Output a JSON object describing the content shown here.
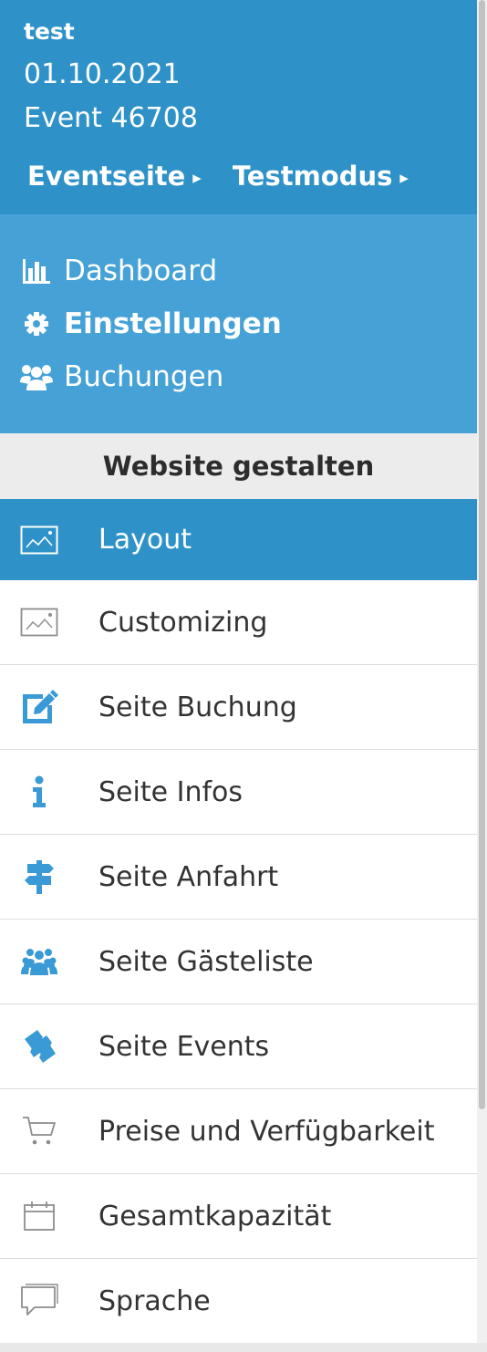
{
  "event": {
    "name": "test",
    "date": "01.10.2021",
    "id": "Event 46708",
    "links": [
      {
        "label": "Eventseite",
        "arrow": "▸"
      },
      {
        "label": "Testmodus",
        "arrow": "▸"
      }
    ]
  },
  "nav": {
    "items": [
      {
        "label": "Dashboard",
        "icon": "bar-chart-icon"
      },
      {
        "label": "Einstellungen",
        "icon": "gear-icon",
        "active": true
      },
      {
        "label": "Buchungen",
        "icon": "users-icon"
      }
    ]
  },
  "section": {
    "title": "Website gestalten"
  },
  "menu": {
    "items": [
      {
        "label": "Layout",
        "icon": "picture-icon",
        "active": true
      },
      {
        "label": "Customizing",
        "icon": "picture-icon"
      },
      {
        "label": "Seite Buchung",
        "icon": "edit-icon"
      },
      {
        "label": "Seite Infos",
        "icon": "info-icon"
      },
      {
        "label": "Seite Anfahrt",
        "icon": "signpost-icon"
      },
      {
        "label": "Seite Gästeliste",
        "icon": "users-icon"
      },
      {
        "label": "Seite Events",
        "icon": "tickets-icon"
      },
      {
        "label": "Preise und Verfügbarkeit",
        "icon": "cart-icon"
      },
      {
        "label": "Gesamtkapazität",
        "icon": "calendar-icon"
      },
      {
        "label": "Sprache",
        "icon": "speech-bubble-icon"
      }
    ]
  },
  "colors": {
    "primary": "#2e92c9",
    "nav_bg": "#46a2d6",
    "section_bg": "#ececec",
    "icon_blue": "#3a9ad6",
    "icon_gray": "#888888"
  }
}
